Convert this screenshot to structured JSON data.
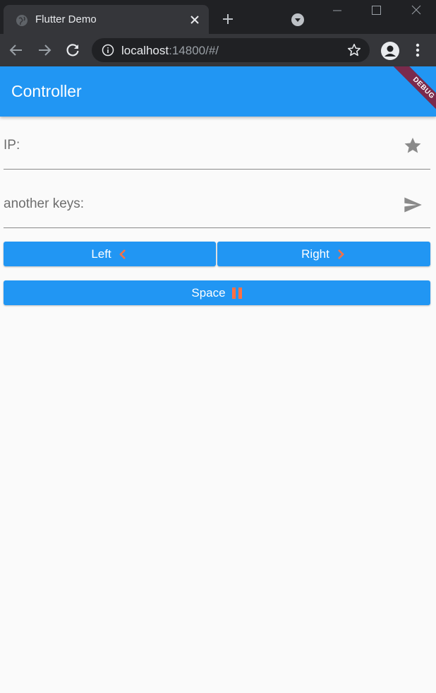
{
  "browser": {
    "tab_title": "Flutter Demo",
    "url_host": "localhost",
    "url_rest": ":14800/#/"
  },
  "app": {
    "title": "Controller",
    "debug_banner": "DEBUG",
    "colors": {
      "primary": "#2196f3",
      "accent": "#ff7043",
      "banner": "#7a2a4c"
    }
  },
  "fields": {
    "ip": {
      "placeholder": "IP:",
      "value": "",
      "icon": "star-icon"
    },
    "keys": {
      "placeholder": "another keys:",
      "value": "",
      "icon": "send-icon"
    }
  },
  "buttons": {
    "left": {
      "label": "Left",
      "icon": "chevron-left-icon"
    },
    "right": {
      "label": "Right",
      "icon": "chevron-right-icon"
    },
    "space": {
      "label": "Space",
      "icon": "pause-icon"
    }
  }
}
